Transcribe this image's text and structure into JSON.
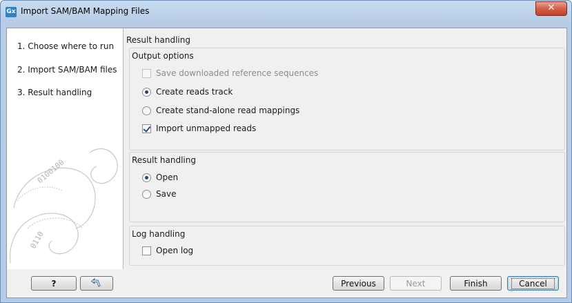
{
  "window": {
    "title": "Import SAM/BAM Mapping Files",
    "app_icon_text": "Gx",
    "close_symbol": "✕"
  },
  "steps": [
    {
      "label": "1.  Choose where to run"
    },
    {
      "label": "2.  Import SAM/BAM files"
    },
    {
      "label": "3.  Result handling"
    }
  ],
  "panel": {
    "title": "Result handling",
    "output_options": {
      "label": "Output options",
      "items": [
        {
          "label": "Save downloaded reference sequences",
          "type": "checkbox",
          "checked": false,
          "enabled": false
        },
        {
          "label": "Create reads track",
          "type": "radio",
          "checked": true,
          "enabled": true
        },
        {
          "label": "Create stand-alone read mappings",
          "type": "radio",
          "checked": false,
          "enabled": true
        },
        {
          "label": "Import unmapped reads",
          "type": "checkbox",
          "checked": true,
          "enabled": true
        }
      ]
    },
    "result_handling": {
      "label": "Result handling",
      "items": [
        {
          "label": "Open",
          "type": "radio",
          "checked": true
        },
        {
          "label": "Save",
          "type": "radio",
          "checked": false
        }
      ]
    },
    "log_handling": {
      "label": "Log handling",
      "items": [
        {
          "label": "Open log",
          "type": "checkbox",
          "checked": false
        }
      ]
    }
  },
  "footer": {
    "help_label": "?",
    "reset_icon": "undo-arrow-icon",
    "previous_label": "Previous",
    "next_label": "Next",
    "finish_label": "Finish",
    "cancel_label": "Cancel"
  }
}
